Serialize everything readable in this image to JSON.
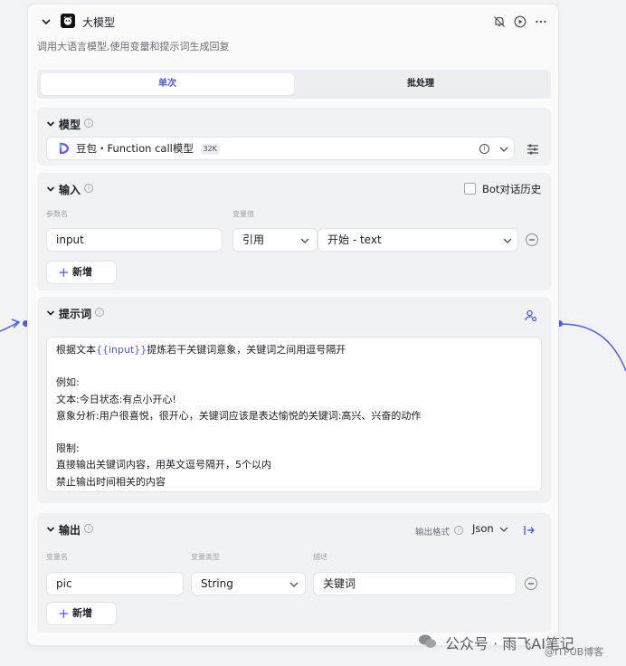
{
  "node": {
    "title": "大模型",
    "description": "调用大语言模型,使用变量和提示词生成回复"
  },
  "tabs": {
    "single": "单次",
    "batch": "批处理"
  },
  "model": {
    "section_title": "模型",
    "selected": "豆包・Function call模型",
    "badge": "32K"
  },
  "input": {
    "section_title": "输入",
    "bot_history_label": "Bot对话历史",
    "col_param_name": "参数名",
    "col_var_value": "变量值",
    "rows": [
      {
        "name": "input",
        "type": "引用",
        "value": "开始 - text"
      }
    ],
    "add_label": "新增"
  },
  "prompt": {
    "section_title": "提示词",
    "lines": [
      {
        "pre": "根据文本",
        "var": "{{input}}",
        "post": "提炼若干关键词意象，关键词之间用逗号隔开"
      },
      {
        "pre": "",
        "var": "",
        "post": ""
      },
      {
        "pre": "例如:",
        "var": "",
        "post": ""
      },
      {
        "pre": "文本:今日状态:有点小开心!",
        "var": "",
        "post": ""
      },
      {
        "pre": "意象分析:用户很喜悦，很开心，关键词应该是表达愉悦的关键词:高兴、兴奋的动作",
        "var": "",
        "post": ""
      },
      {
        "pre": "",
        "var": "",
        "post": ""
      },
      {
        "pre": "限制:",
        "var": "",
        "post": ""
      },
      {
        "pre": "直接输出关键词内容，用英文逗号隔开，5个以内",
        "var": "",
        "post": ""
      },
      {
        "pre": "禁止输出时间相关的内容",
        "var": "",
        "post": ""
      }
    ]
  },
  "output": {
    "section_title": "输出",
    "format_label": "输出格式",
    "format_value": "Json",
    "col_var_name": "变量名",
    "col_var_type": "变量类型",
    "col_desc": "描述",
    "rows": [
      {
        "name": "pic",
        "type": "String",
        "desc": "关键词"
      }
    ],
    "add_label": "新增"
  },
  "watermark": {
    "main": "公众号 · 雨飞AI笔记",
    "sub": "@ITPUB博客"
  },
  "colors": {
    "accent": "#4e5de0",
    "section_bg": "#f1f2f4",
    "card_bg": "#fbfbfc"
  }
}
